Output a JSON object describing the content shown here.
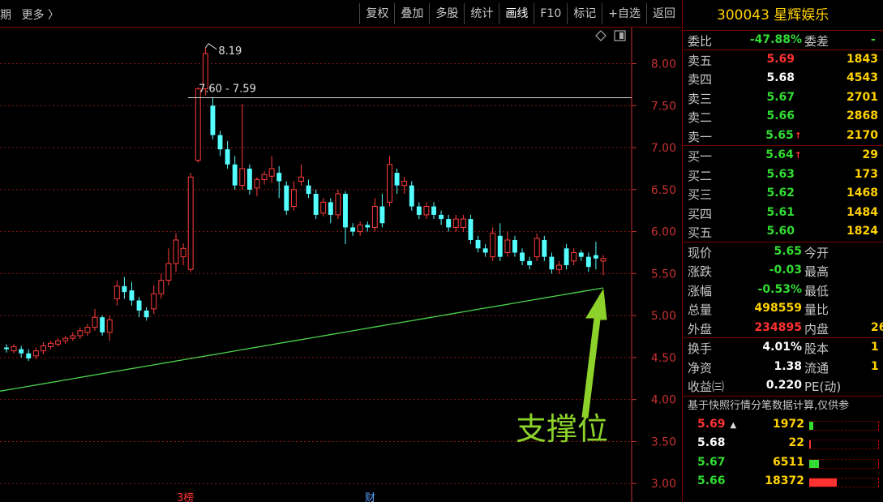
{
  "toolbar": {
    "period_label": "期",
    "more_label": "更多 〉",
    "buttons": [
      "复权",
      "叠加",
      "多股",
      "统计",
      "画线",
      "F10",
      "标记",
      "+自选",
      "返回"
    ],
    "active_button": "画线"
  },
  "chart": {
    "y_ticks": [
      "8.00",
      "7.50",
      "7.00",
      "6.50",
      "6.00",
      "5.50",
      "5.00",
      "4.50",
      "4.00",
      "3.50",
      "3.00"
    ],
    "high_label": "8.19",
    "line_label": "7.60 - 7.59",
    "annotation_text": "支撑位",
    "bottom_marker_left": "3榜",
    "bottom_marker_right": "财",
    "colors": {
      "up": "#ff3c3c",
      "down": "#54ffff",
      "ma": "#4cd24c",
      "axis": "#c83232",
      "annotation": "#8cd22a"
    }
  },
  "chart_data": {
    "type": "candlestick",
    "ylim": [
      2.78,
      8.43
    ],
    "ma_line": {
      "start": 4.1,
      "end": 5.33
    },
    "horizontal_line_level": 7.595,
    "candles": [
      {
        "o": 4.62,
        "c": 4.6,
        "h": 4.66,
        "l": 4.56
      },
      {
        "o": 4.58,
        "c": 4.63,
        "h": 4.66,
        "l": 4.55
      },
      {
        "o": 4.6,
        "c": 4.55,
        "h": 4.64,
        "l": 4.5
      },
      {
        "o": 4.55,
        "c": 4.49,
        "h": 4.6,
        "l": 4.46
      },
      {
        "o": 4.52,
        "c": 4.58,
        "h": 4.62,
        "l": 4.48
      },
      {
        "o": 4.58,
        "c": 4.64,
        "h": 4.68,
        "l": 4.54
      },
      {
        "o": 4.63,
        "c": 4.67,
        "h": 4.7,
        "l": 4.6
      },
      {
        "o": 4.66,
        "c": 4.7,
        "h": 4.73,
        "l": 4.63
      },
      {
        "o": 4.7,
        "c": 4.73,
        "h": 4.76,
        "l": 4.66
      },
      {
        "o": 4.73,
        "c": 4.76,
        "h": 4.8,
        "l": 4.7
      },
      {
        "o": 4.76,
        "c": 4.82,
        "h": 4.86,
        "l": 4.72
      },
      {
        "o": 4.8,
        "c": 4.86,
        "h": 4.9,
        "l": 4.76
      },
      {
        "o": 4.86,
        "c": 4.98,
        "h": 5.08,
        "l": 4.82
      },
      {
        "o": 4.98,
        "c": 4.8,
        "h": 5.0,
        "l": 4.76
      },
      {
        "o": 4.8,
        "c": 4.95,
        "h": 5.0,
        "l": 4.7
      },
      {
        "o": 5.2,
        "c": 5.35,
        "h": 5.42,
        "l": 5.12
      },
      {
        "o": 5.35,
        "c": 5.28,
        "h": 5.46,
        "l": 5.2
      },
      {
        "o": 5.3,
        "c": 5.18,
        "h": 5.4,
        "l": 5.12
      },
      {
        "o": 5.18,
        "c": 5.06,
        "h": 5.22,
        "l": 4.98
      },
      {
        "o": 5.06,
        "c": 4.98,
        "h": 5.1,
        "l": 4.94
      },
      {
        "o": 5.08,
        "c": 5.26,
        "h": 5.36,
        "l": 5.02
      },
      {
        "o": 5.26,
        "c": 5.42,
        "h": 5.5,
        "l": 5.2
      },
      {
        "o": 5.42,
        "c": 5.62,
        "h": 5.8,
        "l": 5.36
      },
      {
        "o": 5.62,
        "c": 5.9,
        "h": 5.98,
        "l": 5.52
      },
      {
        "o": 5.7,
        "c": 5.8,
        "h": 5.86,
        "l": 5.6
      },
      {
        "o": 5.55,
        "c": 6.65,
        "h": 6.7,
        "l": 5.52
      },
      {
        "o": 6.85,
        "c": 7.7,
        "h": 7.72,
        "l": 6.82
      },
      {
        "o": 7.7,
        "c": 8.12,
        "h": 8.19,
        "l": 7.62
      },
      {
        "o": 7.5,
        "c": 7.15,
        "h": 7.6,
        "l": 7.1
      },
      {
        "o": 7.15,
        "c": 6.98,
        "h": 7.2,
        "l": 6.9
      },
      {
        "o": 6.98,
        "c": 6.8,
        "h": 7.08,
        "l": 6.75
      },
      {
        "o": 6.8,
        "c": 6.55,
        "h": 6.9,
        "l": 6.5
      },
      {
        "o": 6.55,
        "c": 6.75,
        "h": 7.52,
        "l": 6.5
      },
      {
        "o": 6.75,
        "c": 6.5,
        "h": 6.8,
        "l": 6.44
      },
      {
        "o": 6.52,
        "c": 6.62,
        "h": 6.65,
        "l": 6.42
      },
      {
        "o": 6.62,
        "c": 6.68,
        "h": 6.72,
        "l": 6.56
      },
      {
        "o": 6.66,
        "c": 6.75,
        "h": 6.9,
        "l": 6.58
      },
      {
        "o": 6.7,
        "c": 6.6,
        "h": 6.78,
        "l": 6.4
      },
      {
        "o": 6.55,
        "c": 6.25,
        "h": 6.6,
        "l": 6.2
      },
      {
        "o": 6.3,
        "c": 6.5,
        "h": 6.6,
        "l": 6.25
      },
      {
        "o": 6.6,
        "c": 6.65,
        "h": 6.8,
        "l": 6.55
      },
      {
        "o": 6.55,
        "c": 6.45,
        "h": 6.62,
        "l": 6.4
      },
      {
        "o": 6.45,
        "c": 6.2,
        "h": 6.5,
        "l": 6.15
      },
      {
        "o": 6.22,
        "c": 6.35,
        "h": 6.4,
        "l": 6.18
      },
      {
        "o": 6.35,
        "c": 6.2,
        "h": 6.4,
        "l": 6.1
      },
      {
        "o": 6.2,
        "c": 6.45,
        "h": 6.5,
        "l": 6.15
      },
      {
        "o": 6.45,
        "c": 6.05,
        "h": 6.48,
        "l": 5.85
      },
      {
        "o": 6.05,
        "c": 6.0,
        "h": 6.1,
        "l": 5.95
      },
      {
        "o": 6.0,
        "c": 6.08,
        "h": 6.12,
        "l": 5.95
      },
      {
        "o": 6.08,
        "c": 6.05,
        "h": 6.12,
        "l": 6.0
      },
      {
        "o": 6.05,
        "c": 6.3,
        "h": 6.4,
        "l": 6.0
      },
      {
        "o": 6.3,
        "c": 6.1,
        "h": 6.45,
        "l": 6.05
      },
      {
        "o": 6.35,
        "c": 6.8,
        "h": 6.9,
        "l": 6.3
      },
      {
        "o": 6.7,
        "c": 6.55,
        "h": 6.75,
        "l": 6.45
      },
      {
        "o": 6.55,
        "c": 6.6,
        "h": 6.65,
        "l": 6.45
      },
      {
        "o": 6.55,
        "c": 6.3,
        "h": 6.6,
        "l": 6.25
      },
      {
        "o": 6.3,
        "c": 6.2,
        "h": 6.35,
        "l": 6.15
      },
      {
        "o": 6.2,
        "c": 6.3,
        "h": 6.35,
        "l": 6.15
      },
      {
        "o": 6.3,
        "c": 6.2,
        "h": 6.35,
        "l": 6.15
      },
      {
        "o": 6.2,
        "c": 6.15,
        "h": 6.25,
        "l": 6.08
      },
      {
        "o": 6.15,
        "c": 6.05,
        "h": 6.2,
        "l": 6.0
      },
      {
        "o": 6.05,
        "c": 6.15,
        "h": 6.2,
        "l": 6.0
      },
      {
        "o": 6.05,
        "c": 6.15,
        "h": 6.2,
        "l": 6.0
      },
      {
        "o": 6.15,
        "c": 5.9,
        "h": 6.2,
        "l": 5.85
      },
      {
        "o": 5.9,
        "c": 5.8,
        "h": 5.95,
        "l": 5.75
      },
      {
        "o": 5.8,
        "c": 5.75,
        "h": 5.85,
        "l": 5.7
      },
      {
        "o": 5.7,
        "c": 5.98,
        "h": 6.05,
        "l": 5.65
      },
      {
        "o": 5.95,
        "c": 5.7,
        "h": 6.1,
        "l": 5.65
      },
      {
        "o": 5.75,
        "c": 5.9,
        "h": 6.0,
        "l": 5.7
      },
      {
        "o": 5.9,
        "c": 5.75,
        "h": 5.95,
        "l": 5.7
      },
      {
        "o": 5.75,
        "c": 5.65,
        "h": 5.8,
        "l": 5.6
      },
      {
        "o": 5.65,
        "c": 5.6,
        "h": 5.7,
        "l": 5.55
      },
      {
        "o": 5.7,
        "c": 5.92,
        "h": 5.98,
        "l": 5.65
      },
      {
        "o": 5.9,
        "c": 5.7,
        "h": 5.95,
        "l": 5.65
      },
      {
        "o": 5.7,
        "c": 5.55,
        "h": 5.75,
        "l": 5.5
      },
      {
        "o": 5.55,
        "c": 5.6,
        "h": 5.65,
        "l": 5.5
      },
      {
        "o": 5.8,
        "c": 5.6,
        "h": 5.85,
        "l": 5.55
      },
      {
        "o": 5.65,
        "c": 5.75,
        "h": 5.8,
        "l": 5.6
      },
      {
        "o": 5.75,
        "c": 5.7,
        "h": 5.78,
        "l": 5.65
      },
      {
        "o": 5.7,
        "c": 5.58,
        "h": 5.75,
        "l": 5.52
      },
      {
        "o": 5.72,
        "c": 5.68,
        "h": 5.88,
        "l": 5.55
      },
      {
        "o": 5.65,
        "c": 5.68,
        "h": 5.72,
        "l": 5.48
      }
    ]
  },
  "quote": {
    "title": "300043 星辉娱乐",
    "ratio": {
      "label1": "委比",
      "value": "-47.88%",
      "label2": "委差",
      "extra": "-"
    },
    "asks": [
      {
        "label": "卖五",
        "price": "5.69",
        "vol": "1843",
        "color": "#ff3232",
        "arrow": ""
      },
      {
        "label": "卖四",
        "price": "5.68",
        "vol": "4543",
        "color": "#ffffff",
        "arrow": ""
      },
      {
        "label": "卖三",
        "price": "5.67",
        "vol": "2701",
        "color": "#32dc32",
        "arrow": ""
      },
      {
        "label": "卖二",
        "price": "5.66",
        "vol": "2868",
        "color": "#32dc32",
        "arrow": ""
      },
      {
        "label": "卖一",
        "price": "5.65",
        "vol": "2170",
        "color": "#32dc32",
        "arrow": "↑"
      }
    ],
    "bids": [
      {
        "label": "买一",
        "price": "5.64",
        "vol": "29",
        "color": "#32dc32",
        "arrow": "↑"
      },
      {
        "label": "买二",
        "price": "5.63",
        "vol": "173",
        "color": "#32dc32",
        "arrow": ""
      },
      {
        "label": "买三",
        "price": "5.62",
        "vol": "1468",
        "color": "#32dc32",
        "arrow": ""
      },
      {
        "label": "买四",
        "price": "5.61",
        "vol": "1484",
        "color": "#32dc32",
        "arrow": ""
      },
      {
        "label": "买五",
        "price": "5.60",
        "vol": "1824",
        "color": "#32dc32",
        "arrow": ""
      }
    ],
    "stats1": [
      {
        "label": "现价",
        "value": "5.65",
        "color": "#32dc32",
        "label2": "今开",
        "extra": ""
      },
      {
        "label": "涨跌",
        "value": "-0.03",
        "color": "#32dc32",
        "label2": "最高",
        "extra": ""
      },
      {
        "label": "涨幅",
        "value": "-0.53%",
        "color": "#32dc32",
        "label2": "最低",
        "extra": ""
      },
      {
        "label": "总量",
        "value": "498559",
        "color": "#ffd200",
        "label2": "量比",
        "extra": ""
      },
      {
        "label": "外盘",
        "value": "234895",
        "color": "#ff3232",
        "label2": "内盘",
        "extra": "26"
      }
    ],
    "stats2": [
      {
        "label": "换手",
        "value": "4.01%",
        "color": "#ffffff",
        "label2": "股本",
        "extra": "1"
      },
      {
        "label": "净资",
        "value": "1.38",
        "color": "#ffffff",
        "label2": "流通",
        "extra": "1"
      },
      {
        "label": "收益㈢",
        "value": "0.220",
        "color": "#ffffff",
        "label2": "PE(动)",
        "extra": ""
      }
    ],
    "note": "基于快照行情分笔数据计算,仅供参",
    "ticks": [
      {
        "price": "5.69",
        "arrow": "▲",
        "vol": "1972",
        "color": "#ff3232",
        "fill": 0.06,
        "fill_color": "#32dc32"
      },
      {
        "price": "5.68",
        "arrow": "",
        "vol": "22",
        "color": "#ffffff",
        "fill": 0.02,
        "fill_color": "#ff3232"
      },
      {
        "price": "5.67",
        "arrow": "",
        "vol": "6511",
        "color": "#32dc32",
        "fill": 0.14,
        "fill_color": "#32dc32"
      },
      {
        "price": "5.66",
        "arrow": "",
        "vol": "18372",
        "color": "#32dc32",
        "fill": 0.4,
        "fill_color": "#ff3232"
      }
    ]
  }
}
